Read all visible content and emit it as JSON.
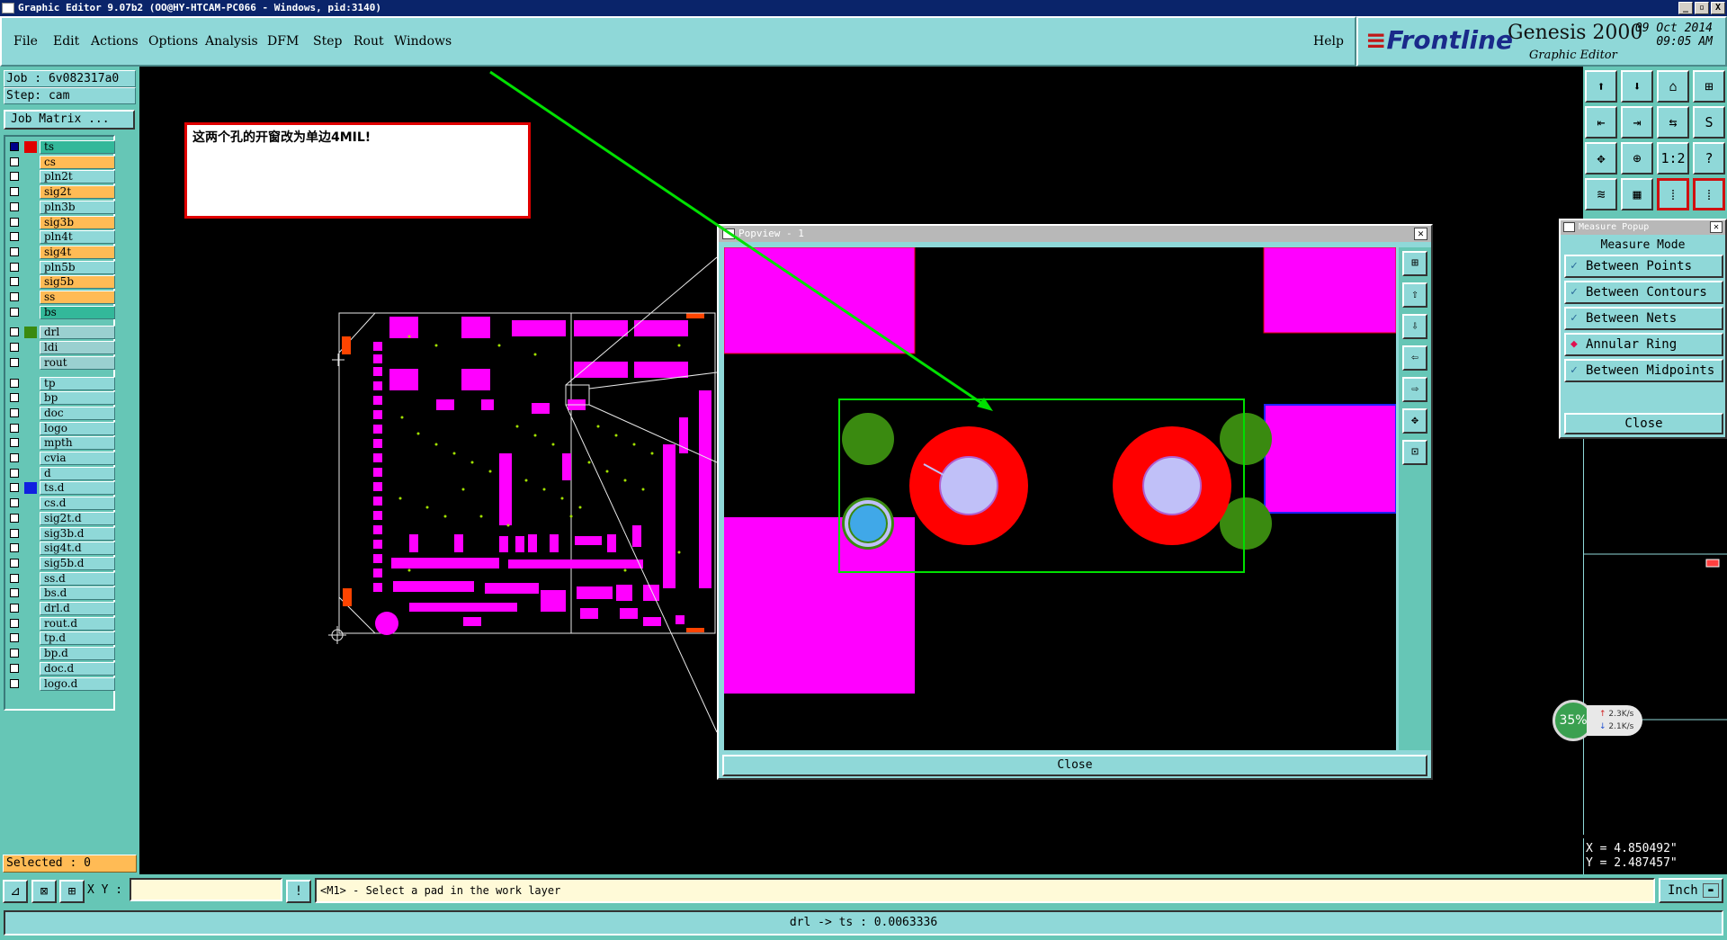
{
  "window": {
    "title": "Graphic Editor 9.07b2 (OO@HY-HTCAM-PC066 - Windows, pid:3140)",
    "buttons": [
      "_",
      "▫",
      "X"
    ]
  },
  "menu": {
    "items": [
      "File",
      "Edit",
      "Actions",
      "Options",
      "Analysis",
      "DFM",
      "Step",
      "Rout",
      "Windows"
    ],
    "help": "Help"
  },
  "brand": {
    "logo": "Frontline",
    "product": "Genesis 2000",
    "subtitle": "Graphic Editor",
    "date": "09 Oct 2014",
    "time": "09:05 AM"
  },
  "job": {
    "job_line": "Job : 6v082317a0",
    "step_line": "Step: cam",
    "matrix_label": "Job Matrix ..."
  },
  "layers": [
    {
      "name": "ts",
      "state": "act",
      "color": "#e00000",
      "checked": true
    },
    {
      "name": "cs",
      "state": "sel",
      "color": "",
      "checked": false
    },
    {
      "name": "pln2t",
      "state": "",
      "color": "",
      "checked": false
    },
    {
      "name": "sig2t",
      "state": "sel",
      "color": "",
      "checked": false
    },
    {
      "name": "pln3b",
      "state": "",
      "color": "",
      "checked": false
    },
    {
      "name": "sig3b",
      "state": "sel",
      "color": "",
      "checked": false
    },
    {
      "name": "pln4t",
      "state": "",
      "color": "",
      "checked": false
    },
    {
      "name": "sig4t",
      "state": "sel",
      "color": "",
      "checked": false
    },
    {
      "name": "pln5b",
      "state": "",
      "color": "",
      "checked": false
    },
    {
      "name": "sig5b",
      "state": "sel",
      "color": "",
      "checked": false
    },
    {
      "name": "ss",
      "state": "sel",
      "color": "",
      "checked": false
    },
    {
      "name": "bs",
      "state": "act",
      "color": "",
      "checked": false
    },
    {
      "name": "drl",
      "state": "drill",
      "color": "#3a8a10",
      "checked": false
    },
    {
      "name": "ldi",
      "state": "drill",
      "color": "",
      "checked": false
    },
    {
      "name": "rout",
      "state": "drill",
      "color": "",
      "checked": false
    },
    {
      "name": "tp",
      "state": "",
      "color": "",
      "checked": false
    },
    {
      "name": "bp",
      "state": "",
      "color": "",
      "checked": false
    },
    {
      "name": "doc",
      "state": "",
      "color": "",
      "checked": false
    },
    {
      "name": "logo",
      "state": "",
      "color": "",
      "checked": false
    },
    {
      "name": "mpth",
      "state": "",
      "color": "",
      "checked": false
    },
    {
      "name": "cvia",
      "state": "",
      "color": "",
      "checked": false
    },
    {
      "name": "d",
      "state": "",
      "color": "",
      "checked": false
    },
    {
      "name": "ts.d",
      "state": "",
      "color": "#1020e0",
      "checked": false
    },
    {
      "name": "cs.d",
      "state": "",
      "color": "",
      "checked": false
    },
    {
      "name": "sig2t.d",
      "state": "",
      "color": "",
      "checked": false
    },
    {
      "name": "sig3b.d",
      "state": "",
      "color": "",
      "checked": false
    },
    {
      "name": "sig4t.d",
      "state": "",
      "color": "",
      "checked": false
    },
    {
      "name": "sig5b.d",
      "state": "",
      "color": "",
      "checked": false
    },
    {
      "name": "ss.d",
      "state": "",
      "color": "",
      "checked": false
    },
    {
      "name": "bs.d",
      "state": "",
      "color": "",
      "checked": false
    },
    {
      "name": "drl.d",
      "state": "",
      "color": "",
      "checked": false
    },
    {
      "name": "rout.d",
      "state": "",
      "color": "",
      "checked": false
    },
    {
      "name": "tp.d",
      "state": "",
      "color": "",
      "checked": false
    },
    {
      "name": "bp.d",
      "state": "",
      "color": "",
      "checked": false
    },
    {
      "name": "doc.d",
      "state": "",
      "color": "",
      "checked": false
    },
    {
      "name": "logo.d",
      "state": "",
      "color": "",
      "checked": false
    }
  ],
  "selected": "Selected : 0",
  "note": "这两个孔的开窗改为单边4MIL!",
  "popview": {
    "title": "Popview - 1",
    "close_label": "Close"
  },
  "measure": {
    "title": "Measure Popup",
    "heading": "Measure Mode",
    "options": [
      {
        "label": "Between Points",
        "mark": "check"
      },
      {
        "label": "Between Contours",
        "mark": "check"
      },
      {
        "label": "Between Nets",
        "mark": "check"
      },
      {
        "label": "Annular Ring",
        "mark": "diamond"
      },
      {
        "label": "Between Midpoints",
        "mark": "check"
      }
    ],
    "close_label": "Close"
  },
  "coords": {
    "x": "X = 4.850492\"",
    "y": "Y = 2.487457\""
  },
  "speed": {
    "percent": "35%",
    "up": "2.3K/s",
    "down": "2.1K/s"
  },
  "bottom": {
    "xy_label": "X Y :",
    "prompt": "<M1> - Select a pad in the work layer",
    "units": "Inch"
  },
  "status": "drl -> ts : 0.0063336",
  "colors": {
    "panel": "#8fd8d8",
    "panel_dark": "#66c6b6",
    "pad": "#ff00ff",
    "drill_ring": "#ff0000",
    "hole": "#c0c0f8",
    "via": "#3a8a10",
    "highlight": "#00e000"
  }
}
